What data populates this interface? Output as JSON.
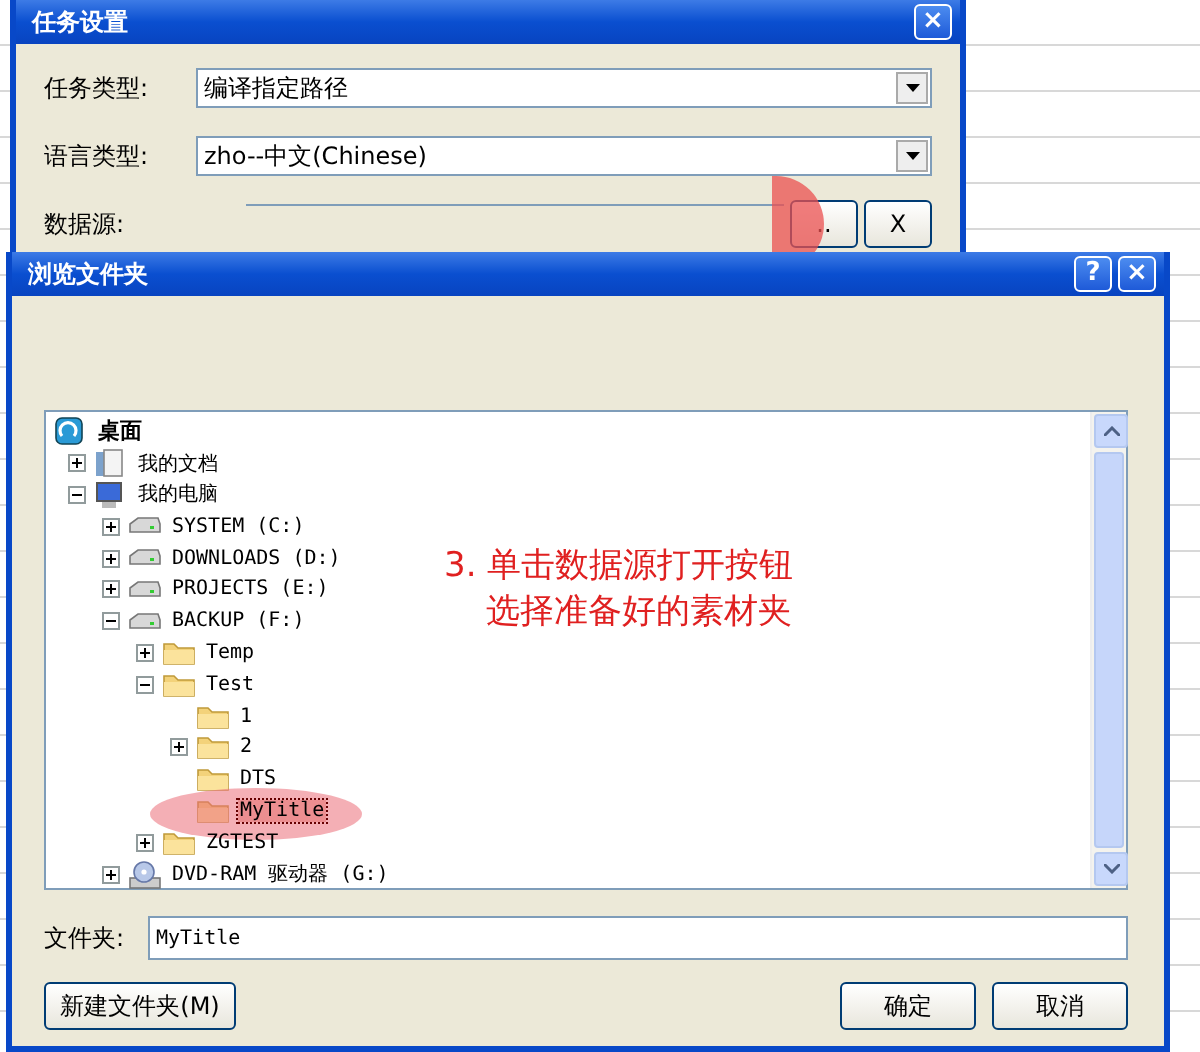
{
  "task_dialog": {
    "title": "任务设置",
    "close_label": "×",
    "fields": [
      {
        "kind": "combo",
        "label": "任务类型:",
        "value": "编译指定路径"
      },
      {
        "kind": "combo",
        "label": "语言类型:",
        "value": "zho--中文(Chinese)"
      },
      {
        "kind": "path",
        "label": "数据源:",
        "browse_label": "..",
        "clear_label": "X",
        "browse_highlighted": true
      }
    ]
  },
  "browse_dialog": {
    "title": "浏览文件夹",
    "help_label": "?",
    "close_label": "×",
    "tree": [
      {
        "label": "桌面",
        "kind": "desktop",
        "selected": false,
        "children": [
          {
            "label": "我的文档",
            "kind": "documents",
            "expanded": false,
            "selected": false
          },
          {
            "label": "我的电脑",
            "kind": "computer",
            "expanded": true,
            "selected": false,
            "children": [
              {
                "label": "SYSTEM (C:)",
                "kind": "drive",
                "expanded": false,
                "selected": false
              },
              {
                "label": "DOWNLOADS (D:)",
                "kind": "drive",
                "expanded": false,
                "selected": false
              },
              {
                "label": "PROJECTS (E:)",
                "kind": "drive",
                "expanded": false,
                "selected": false
              },
              {
                "label": "BACKUP (F:)",
                "kind": "drive",
                "expanded": true,
                "selected": false,
                "children": [
                  {
                    "label": "Temp",
                    "kind": "folder",
                    "expanded": false,
                    "selected": false
                  },
                  {
                    "label": "Test",
                    "kind": "folder",
                    "expanded": true,
                    "selected": false,
                    "children": [
                      {
                        "label": "1",
                        "kind": "folder",
                        "selected": false
                      },
                      {
                        "label": "2",
                        "kind": "folder",
                        "expanded": false,
                        "selected": false
                      },
                      {
                        "label": "DTS",
                        "kind": "folder",
                        "selected": false
                      },
                      {
                        "label": "MyTitle",
                        "kind": "folder",
                        "selected": true,
                        "highlighted": true
                      }
                    ]
                  },
                  {
                    "label": "ZGTEST",
                    "kind": "folder",
                    "expanded": false,
                    "selected": false
                  }
                ]
              },
              {
                "label": "DVD-RAM 驱动器 (G:)",
                "kind": "dvd",
                "expanded": false,
                "selected": false
              }
            ]
          }
        ]
      }
    ],
    "annotation": [
      "3. 单击数据源打开按钮",
      "选择准备好的素材夹"
    ],
    "folder_label": "文件夹:",
    "folder_value": "MyTitle",
    "buttons": [
      {
        "label": "新建文件夹(M)",
        "kind": "new"
      },
      {
        "label": "确定",
        "kind": "ok"
      },
      {
        "label": "取消",
        "kind": "cancel"
      }
    ]
  }
}
